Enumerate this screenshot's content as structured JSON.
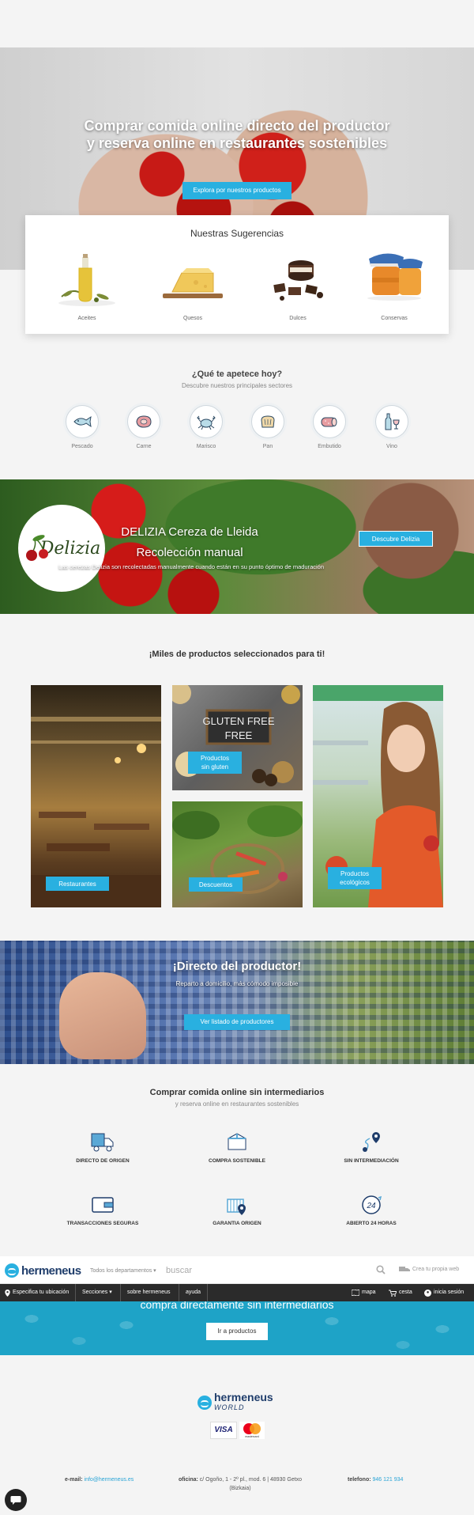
{
  "hero": {
    "title_line1": "Comprar comida online directo del productor",
    "title_line2": "y reserva online en restaurantes sostenibles",
    "button": "Explora por nuestros productos"
  },
  "suggestions": {
    "title": "Nuestras Sugerencias",
    "items": [
      {
        "label": "Aceites",
        "icon": "olive-oil-image"
      },
      {
        "label": "Quesos",
        "icon": "cheese-image"
      },
      {
        "label": "Dulces",
        "icon": "sweets-image"
      },
      {
        "label": "Conservas",
        "icon": "preserves-image"
      }
    ]
  },
  "sectors": {
    "title": "¿Qué te apetece hoy?",
    "subtitle": "Descubre nuestros principales sectores",
    "items": [
      {
        "label": "Pescado",
        "icon": "fish-icon"
      },
      {
        "label": "Carne",
        "icon": "meat-icon"
      },
      {
        "label": "Marisco",
        "icon": "crab-icon"
      },
      {
        "label": "Pan",
        "icon": "bread-icon"
      },
      {
        "label": "Embutido",
        "icon": "sausage-icon"
      },
      {
        "label": "Vino",
        "icon": "wine-icon"
      }
    ]
  },
  "delizia": {
    "logo_text": "Delizia",
    "title_line1": "DELIZIA Cereza de Lleida",
    "title_line2": "Recolección manual",
    "subtitle": "Las cerezas Delizia son recolectadas manualmente cuando están en su punto óptimo de maduración",
    "button": "Descubre Delizia"
  },
  "products": {
    "title": "¡Miles de productos seleccionados para ti!",
    "tiles": [
      {
        "label": "Restaurantes"
      },
      {
        "label_line1": "Productos",
        "label_line2": "sin gluten",
        "sign": "GLUTEN FREE"
      },
      {
        "label": "Descuentos"
      },
      {
        "label_line1": "Productos",
        "label_line2": "ecológicos"
      }
    ]
  },
  "directo": {
    "title": "¡Directo del productor!",
    "subtitle": "Reparto a domicilio, más cómodo imposible",
    "button": "Ver listado de productores"
  },
  "features": {
    "title": "Comprar comida online sin intermediarios",
    "subtitle": "y reserva online en restaurantes sostenibles",
    "items": [
      {
        "label": "DIRECTO DE ORIGEN",
        "icon": "delivery-truck-icon"
      },
      {
        "label": "COMPRA SOSTENIBLE",
        "icon": "box-icon"
      },
      {
        "label": "SIN INTERMEDIACIÓN",
        "icon": "route-pin-icon"
      },
      {
        "label": "TRANSACCIONES SEGURAS",
        "icon": "wallet-icon"
      },
      {
        "label": "GARANTIA ORIGEN",
        "icon": "factory-pin-icon"
      },
      {
        "label": "ABIERTO 24 HORAS",
        "icon": "clock-24-icon"
      }
    ]
  },
  "header": {
    "logo": "hermeneus",
    "departments": "Todos los departamentos",
    "search_placeholder": "buscar",
    "create_shop": "Crea tu propia web",
    "location": "Especifica tu ubicación",
    "nav": [
      "Secciones",
      "sobre hermeneus",
      "ayuda"
    ],
    "map": "mapa",
    "cart": "cesta",
    "login": "inicia sesión"
  },
  "strip": {
    "title": "compra directamente sin intermediarios",
    "button": "Ir a productos"
  },
  "footer": {
    "logo_main": "hermeneus",
    "logo_sub": "WORLD",
    "visa": "VISA",
    "mastercard": "mastercard",
    "email_label": "e-mail:",
    "email": "info@hermeneus.es",
    "office_label": "oficina:",
    "office_line1": "c/ Ogoño, 1 - 2º pl., mod. 6 | 48930 Getxo",
    "office_line2": "(Bizkaia)",
    "phone_label": "telefono:",
    "phone": "946 121 934"
  },
  "colors": {
    "accent": "#29b0e0",
    "nav_bg": "#2b2b2b",
    "strip_bg": "#1ea3c7",
    "brand_dark": "#1f3d6b"
  }
}
